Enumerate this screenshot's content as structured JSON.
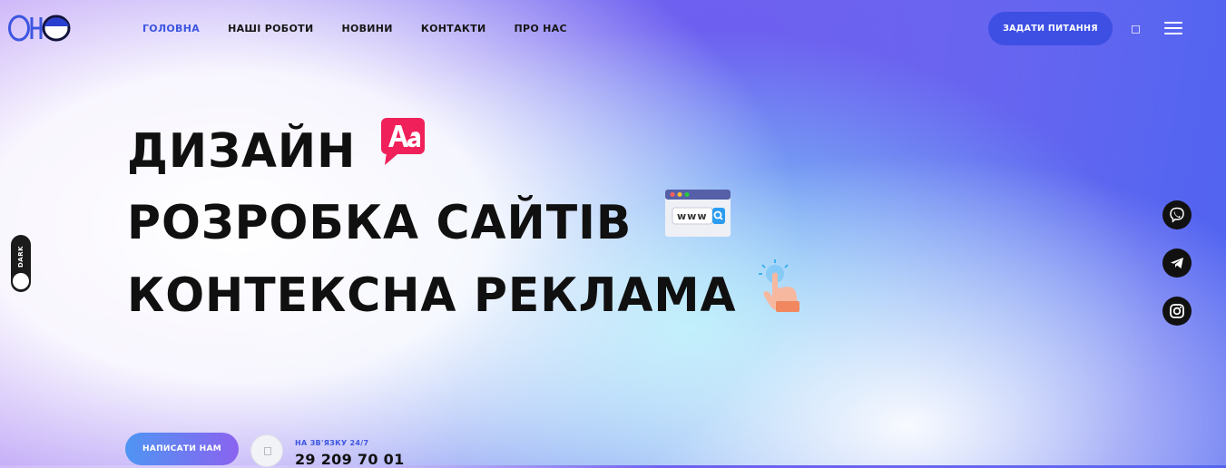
{
  "brand": {
    "logo_alt": "OHO logo"
  },
  "nav": {
    "items": [
      {
        "label": "ГОЛОВНА",
        "active": true
      },
      {
        "label": "НАШІ РОБОТИ",
        "active": false
      },
      {
        "label": "НОВИНИ",
        "active": false
      },
      {
        "label": "КОНТАКТИ",
        "active": false
      },
      {
        "label": "ПРО НАС",
        "active": false
      }
    ],
    "cta_label": "ЗАДАТИ ПИТАННЯ"
  },
  "hero": {
    "lines": [
      "ДИЗАЙН",
      "РОЗРОБКА САЙТІВ",
      "КОНТЕКСНА РЕКЛАМА"
    ],
    "icons": [
      "font-aa-icon",
      "browser-www-icon",
      "pointer-hand-icon"
    ],
    "www_text": "www"
  },
  "theme_toggle": {
    "label": "DARK"
  },
  "social": [
    "viber-icon",
    "telegram-icon",
    "instagram-icon"
  ],
  "contact": {
    "button_label": "НАПИСАТИ НАМ",
    "label": "НА ЗВ'ЯЗКУ 24/7",
    "phone": "29 209 70 01"
  },
  "colors": {
    "accent": "#3e4fe4",
    "active_nav": "#3d56e0",
    "text": "#101010",
    "button_gradient_start": "#4f95f2",
    "button_gradient_end": "#8a63f0"
  }
}
